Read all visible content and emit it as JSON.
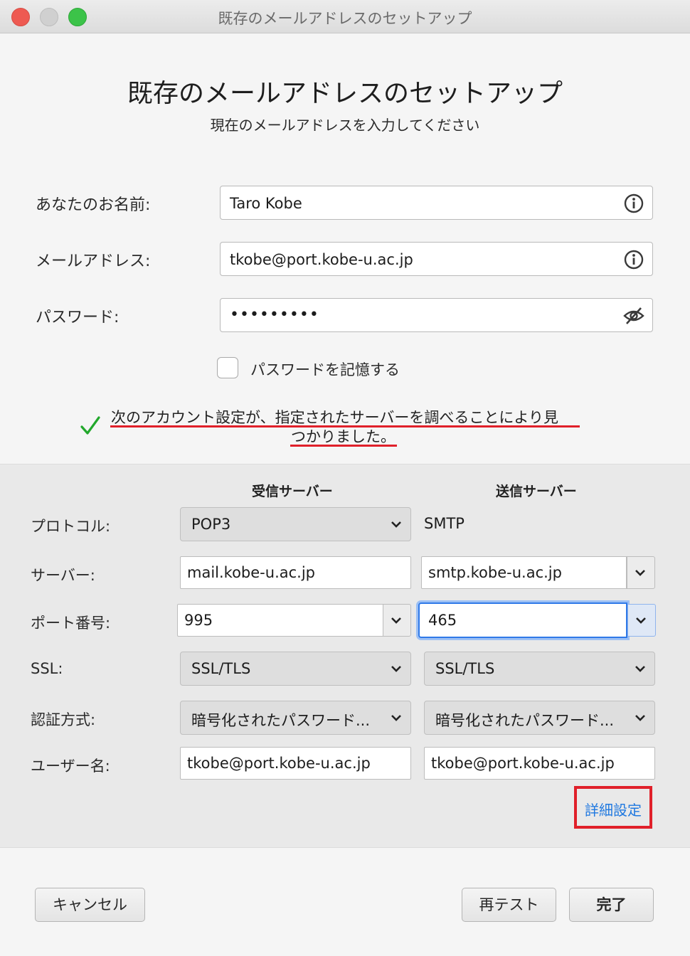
{
  "window": {
    "title": "既存のメールアドレスのセットアップ"
  },
  "header": {
    "title": "既存のメールアドレスのセットアップ",
    "subtitle": "現在のメールアドレスを入力してください"
  },
  "form": {
    "name_label": "あなたのお名前:",
    "name_value": "Taro Kobe",
    "email_label": "メールアドレス:",
    "email_value": "tkobe@port.kobe-u.ac.jp",
    "password_label": "パスワード:",
    "password_value": "•••••••••",
    "remember_label": "パスワードを記憶する",
    "remember_checked": false
  },
  "status": {
    "line1": "次のアカウント設定が、指定されたサーバーを調べることにより見",
    "line2": "つかりました。",
    "color": "#22a82c",
    "underline_color": "#e0202a"
  },
  "servers": {
    "incoming_header": "受信サーバー",
    "outgoing_header": "送信サーバー",
    "labels": {
      "protocol": "プロトコル:",
      "server": "サーバー:",
      "port": "ポート番号:",
      "ssl": "SSL:",
      "auth": "認証方式:",
      "username": "ユーザー名:"
    },
    "incoming": {
      "protocol": "POP3",
      "server": "mail.kobe-u.ac.jp",
      "port": "995",
      "ssl": "SSL/TLS",
      "auth": "暗号化されたパスワード...",
      "username": "tkobe@port.kobe-u.ac.jp"
    },
    "outgoing": {
      "protocol": "SMTP",
      "server": "smtp.kobe-u.ac.jp",
      "port": "465",
      "ssl": "SSL/TLS",
      "auth": "暗号化されたパスワード...",
      "username": "tkobe@port.kobe-u.ac.jp"
    },
    "advanced_link": "詳細設定"
  },
  "buttons": {
    "cancel": "キャンセル",
    "retest": "再テスト",
    "done": "完了"
  },
  "colors": {
    "link": "#1f78e0",
    "focus": "#2f79e8",
    "highlight": "#e0202a"
  }
}
